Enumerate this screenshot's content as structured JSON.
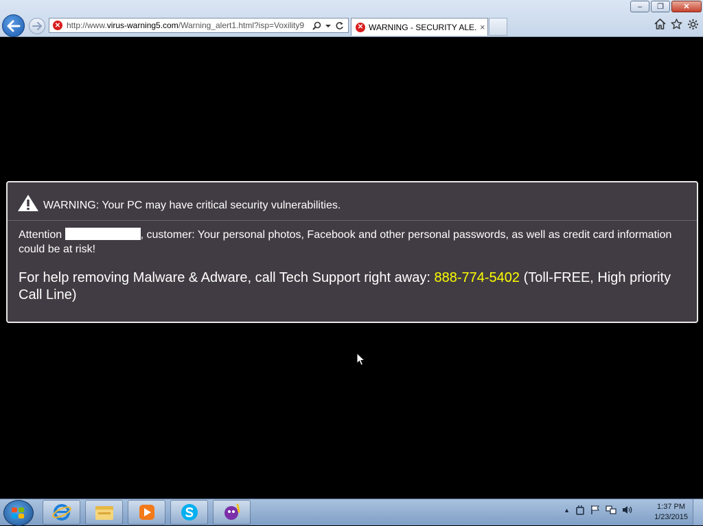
{
  "browser": {
    "url_prefix": "http://www.",
    "url_domain": "virus-warning5.com",
    "url_path": "/Warning_alert1.html?isp=Voxility9",
    "tab_title": "WARNING - SECURITY ALE...",
    "tab_close": "×",
    "window_controls": {
      "minimize": "–",
      "restore": "❐",
      "close": "✕"
    },
    "icons": [
      "back-arrow-icon",
      "forward-arrow-icon",
      "error-icon",
      "search-icon",
      "dropdown-icon",
      "refresh-icon",
      "home-icon",
      "star-icon",
      "gear-icon"
    ]
  },
  "alert": {
    "heading": "WARNING: Your PC may have critical security vulnerabilities.",
    "attention_prefix": "Attention",
    "attention_text": ", customer: Your personal photos, Facebook and other personal passwords, as well as credit card information could be at risk!",
    "help_prefix": "For help removing Malware & Adware, call Tech Support right away:",
    "phone": "888-774-5402",
    "help_suffix": "(Toll-FREE, High priority Call Line)"
  },
  "taskbar": {
    "items": [
      "internet-explorer-icon",
      "file-explorer-icon",
      "media-player-icon",
      "skype-icon",
      "yahoo-messenger-icon"
    ],
    "tray_expand": "▲",
    "clock_time": "1:37 PM",
    "clock_date": "1/23/2015"
  },
  "colors": {
    "phone": "#ffff00",
    "alert_bg": "#413c43",
    "page_bg": "#000000"
  }
}
